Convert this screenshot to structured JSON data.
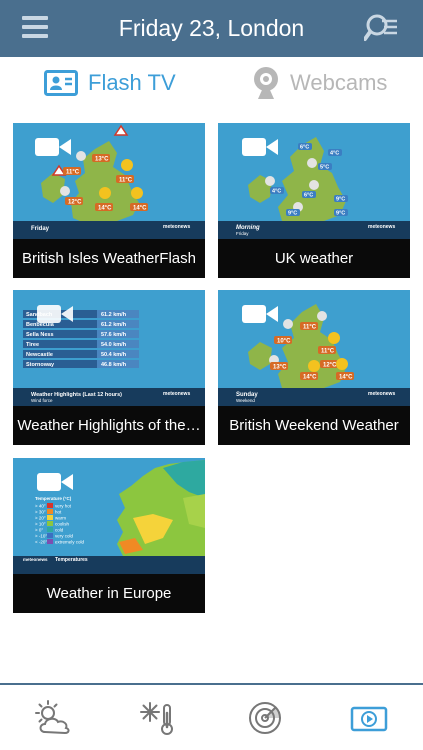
{
  "header": {
    "title": "Friday 23, London"
  },
  "tabs": [
    {
      "label": "Flash TV",
      "active": true,
      "icon": "tv-presenter-icon"
    },
    {
      "label": "Webcams",
      "active": false,
      "icon": "webcam-icon"
    }
  ],
  "videos": [
    {
      "caption": "British Isles WeatherFlash",
      "day": "Friday",
      "temps": [
        "13°C",
        "11°C",
        "11°C",
        "12°C",
        "14°C",
        "14°C"
      ]
    },
    {
      "caption": "UK weather",
      "day": "Morning",
      "sub": "Friday",
      "temps": [
        "4°C",
        "6°C",
        "5°C",
        "4°C",
        "6°C",
        "9°C",
        "9°C",
        "9°C"
      ]
    },
    {
      "caption": "Weather Highlights of the…",
      "title": "Weather Highlights (Last 12 hours)",
      "subtitle": "Wind force",
      "rows": [
        {
          "place": "Sandbach",
          "value": "61.2 km/h"
        },
        {
          "place": "Benbecula",
          "value": "61.2 km/h"
        },
        {
          "place": "Sella Ness",
          "value": "57.6 km/h"
        },
        {
          "place": "Tiree",
          "value": "54.0 km/h"
        },
        {
          "place": "Newcastle",
          "value": "50.4 km/h"
        },
        {
          "place": "Stornoway",
          "value": "46.8 km/h"
        }
      ]
    },
    {
      "caption": "British Weekend Weather",
      "day": "Sunday",
      "sub": "Weekend",
      "temps": [
        "11°C",
        "10°C",
        "11°C",
        "13°C",
        "12°C",
        "14°C",
        "14°C"
      ]
    },
    {
      "caption": "Weather in Europe",
      "legend_title": "Temperature (°C)",
      "legend": [
        {
          "range": "> 40°",
          "label": "very hot",
          "color": "#d8352b"
        },
        {
          "range": "> 30°",
          "label": "hot",
          "color": "#f08a24"
        },
        {
          "range": "> 20°",
          "label": "warm",
          "color": "#f5d33a"
        },
        {
          "range": "> 10°",
          "label": "coolish",
          "color": "#8cc63f"
        },
        {
          "range": "> 0°",
          "label": "cold",
          "color": "#2ea9a0"
        },
        {
          "range": "> -10°",
          "label": "very cold",
          "color": "#3b6fc2"
        },
        {
          "range": "< -20°",
          "label": "extremely cold",
          "color": "#7c4fb0"
        }
      ],
      "footer": "Temperatures"
    }
  ],
  "brand": "meteonews",
  "bottom_nav": [
    {
      "name": "forecast",
      "icon": "sun-cloud-icon",
      "active": false
    },
    {
      "name": "snow",
      "icon": "snow-thermometer-icon",
      "active": false
    },
    {
      "name": "radar",
      "icon": "radar-icon",
      "active": false
    },
    {
      "name": "video",
      "icon": "video-play-icon",
      "active": true
    }
  ],
  "colors": {
    "header": "#4a6f8e",
    "active_tab": "#3d9ed8",
    "inactive_tab": "#b7b7b7"
  }
}
